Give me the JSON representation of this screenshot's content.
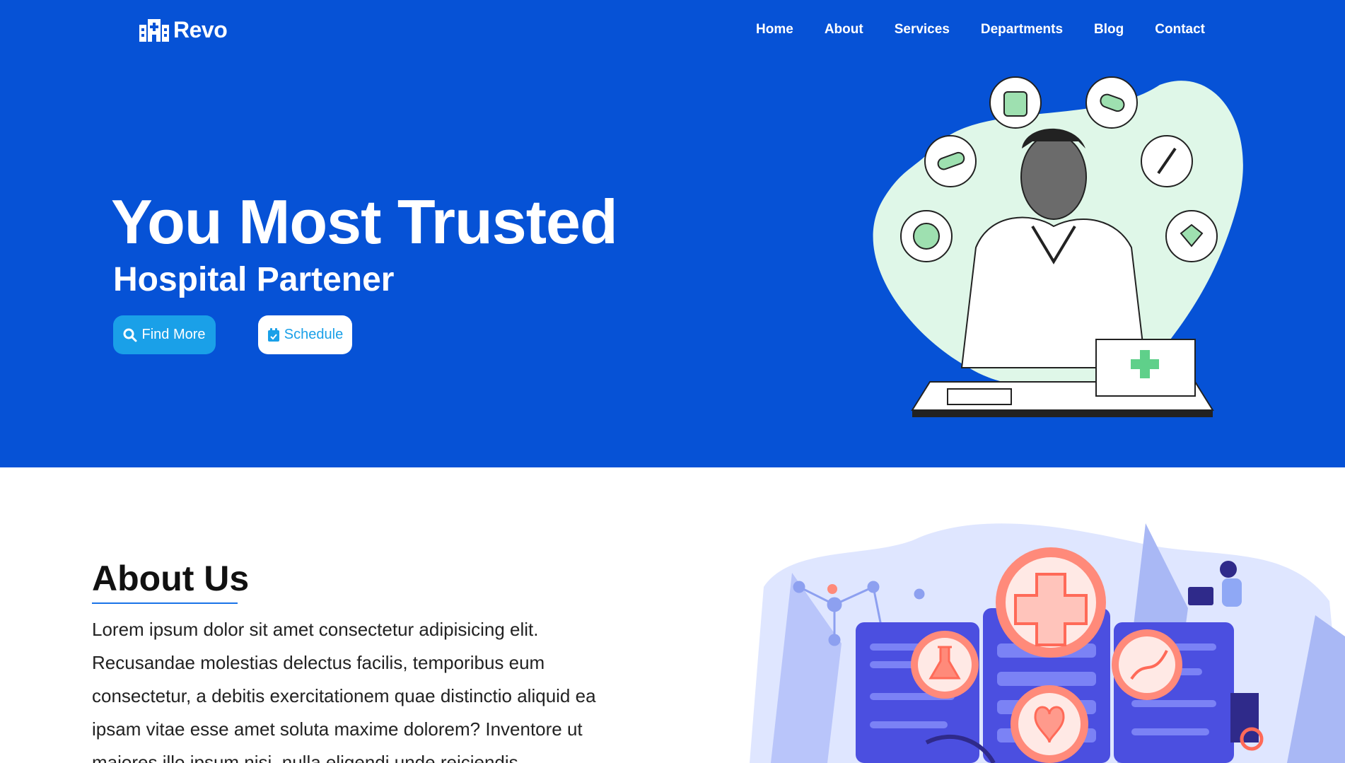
{
  "brand": {
    "name": "Revo"
  },
  "nav": {
    "items": [
      "Home",
      "About",
      "Services",
      "Departments",
      "Blog",
      "Contact"
    ]
  },
  "hero": {
    "title": "You Most Trusted",
    "subtitle": "Hospital Partener",
    "find_label": "Find More",
    "schedule_label": "Schedule"
  },
  "about": {
    "title": "About Us",
    "text": "Lorem ipsum dolor sit amet consectetur adipisicing elit. Recusandae molestias delectus facilis, temporibus eum consectetur, a debitis exercitationem quae distinctio aliquid ea ipsam vitae esse amet soluta maxime dolorem? Inventore ut maiores illo ipsum nisi, nulla eligendi unde reiciendis"
  },
  "colors": {
    "primary": "#0652d6",
    "accent": "#1aa0e8",
    "mint": "#dff7e8"
  }
}
